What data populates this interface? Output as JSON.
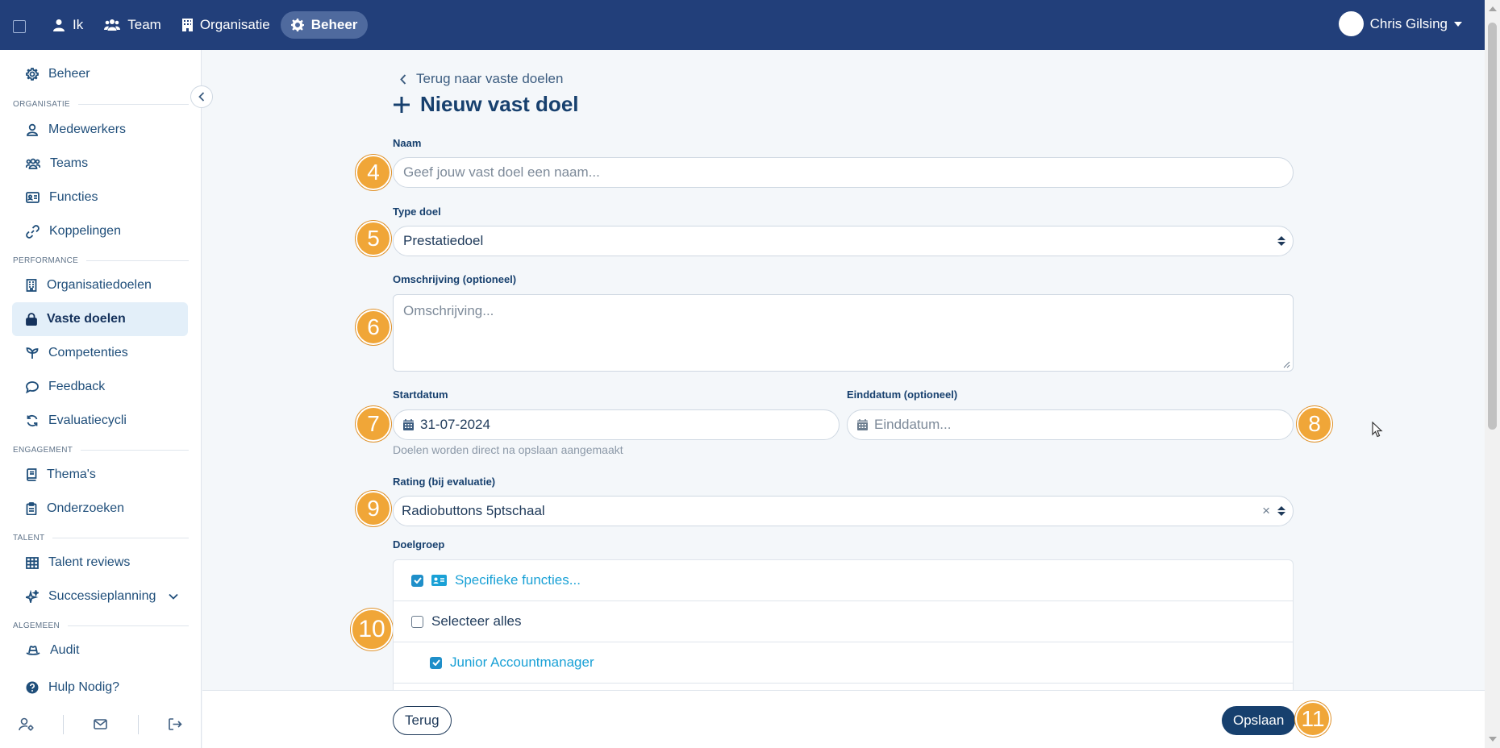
{
  "topnav": {
    "items": [
      {
        "label": "Ik",
        "icon": "user-icon"
      },
      {
        "label": "Team",
        "icon": "users-icon"
      },
      {
        "label": "Organisatie",
        "icon": "building-icon"
      },
      {
        "label": "Beheer",
        "icon": "gear-icon",
        "active": true
      }
    ],
    "user_name": "Chris Gilsing"
  },
  "sidebar": {
    "top_item": "Beheer",
    "sections": {
      "organisatie": "ORGANISATIE",
      "performance": "PERFORMANCE",
      "engagement": "ENGAGEMENT",
      "talent": "TALENT",
      "algemeen": "ALGEMEEN"
    },
    "items": {
      "medewerkers": "Medewerkers",
      "teams": "Teams",
      "functies": "Functies",
      "koppelingen": "Koppelingen",
      "organisatiedoelen": "Organisatiedoelen",
      "vaste_doelen": "Vaste doelen",
      "competenties": "Competenties",
      "feedback": "Feedback",
      "evaluatiecycli": "Evaluatiecycli",
      "themas": "Thema's",
      "onderzoeken": "Onderzoeken",
      "talent_reviews": "Talent reviews",
      "successieplanning": "Successieplanning",
      "audit": "Audit",
      "hulp": "Hulp Nodig?"
    },
    "active": "vaste_doelen"
  },
  "page": {
    "back_link": "Terug naar vaste doelen",
    "title": "Nieuw vast doel"
  },
  "form": {
    "naam": {
      "label": "Naam",
      "placeholder": "Geef jouw vast doel een naam...",
      "marker": "4"
    },
    "type": {
      "label": "Type doel",
      "value": "Prestatiedoel",
      "marker": "5"
    },
    "omschrijving": {
      "label": "Omschrijving (optioneel)",
      "placeholder": "Omschrijving...",
      "marker": "6"
    },
    "startdatum": {
      "label": "Startdatum",
      "value": "31-07-2024",
      "marker": "7",
      "hint": "Doelen worden direct na opslaan aangemaakt"
    },
    "einddatum": {
      "label": "Einddatum (optioneel)",
      "placeholder": "Einddatum...",
      "marker": "8"
    },
    "rating": {
      "label": "Rating (bij evaluatie)",
      "value": "Radiobuttons 5ptschaal",
      "marker": "9",
      "clear": "×"
    },
    "doelgroep": {
      "label": "Doelgroep",
      "marker": "10",
      "rows": [
        {
          "label": "Specifieke functies...",
          "checked": true
        },
        {
          "label": "Selecteer alles",
          "checked": false
        },
        {
          "label": "Junior Accountmanager",
          "checked": true
        }
      ]
    }
  },
  "footer": {
    "back_label": "Terug",
    "save_label": "Opslaan",
    "save_marker": "11"
  },
  "colors": {
    "nav_bg": "#223f7a",
    "primary": "#17406e",
    "marker": "#f0a638",
    "link": "#1aa1d6",
    "checkbox": "#1f8fc9"
  }
}
